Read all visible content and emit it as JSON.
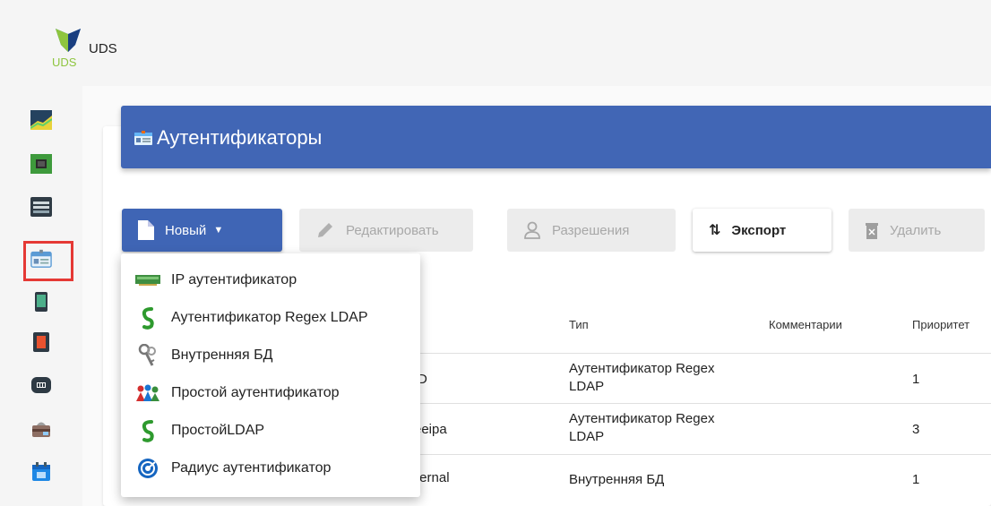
{
  "app": {
    "name": "UDS",
    "logo_text": "UDS"
  },
  "sidebar": {
    "items": [
      {
        "icon": "dashboard-chart-icon"
      },
      {
        "icon": "network-board-icon"
      },
      {
        "icon": "server-icon"
      },
      {
        "icon": "authenticator-id-card-icon",
        "selected": true
      },
      {
        "icon": "os-manager-phone-icon"
      },
      {
        "icon": "transport-device-icon"
      },
      {
        "icon": "network-icon"
      },
      {
        "icon": "proxy-toolbox-icon"
      },
      {
        "icon": "calendar-icon"
      }
    ]
  },
  "header": {
    "title": "Аутентификаторы",
    "icon": "id-card-icon"
  },
  "toolbar": {
    "new_label": "Новый",
    "edit_label": "Редактировать",
    "permissions_label": "Разрешения",
    "export_label": "Экспорт",
    "delete_label": "Удалить"
  },
  "table": {
    "columns": [
      "Тип",
      "Комментарии",
      "Приоритет"
    ],
    "rows": [
      {
        "name_fragment": "D",
        "type_line1": "Аутентификатор Regex",
        "type_line2": "LDAP",
        "comments": "",
        "priority": "1"
      },
      {
        "name_fragment": "eeipa",
        "type_line1": "Аутентификатор Regex",
        "type_line2": "LDAP",
        "comments": "",
        "priority": "3"
      },
      {
        "name_fragment": "ternal",
        "type_line1": "Внутренняя БД",
        "type_line2": "",
        "comments": "",
        "priority": "1"
      }
    ]
  },
  "dropdown": {
    "items": [
      {
        "label": "IP аутентификатор",
        "icon": "ip-network-card-icon"
      },
      {
        "label": "Аутентификатор Regex LDAP",
        "icon": "ldap-s-icon"
      },
      {
        "label": "Внутренняя БД",
        "icon": "keys-icon"
      },
      {
        "label": "Простой аутентификатор",
        "icon": "people-icon"
      },
      {
        "label": "ПростойLDAP",
        "icon": "ldap-s-icon"
      },
      {
        "label": "Радиус аутентификатор",
        "icon": "radius-icon"
      }
    ]
  },
  "colors": {
    "primary": "#3f65b5",
    "header": "#4166b5",
    "highlight": "#e53935"
  }
}
